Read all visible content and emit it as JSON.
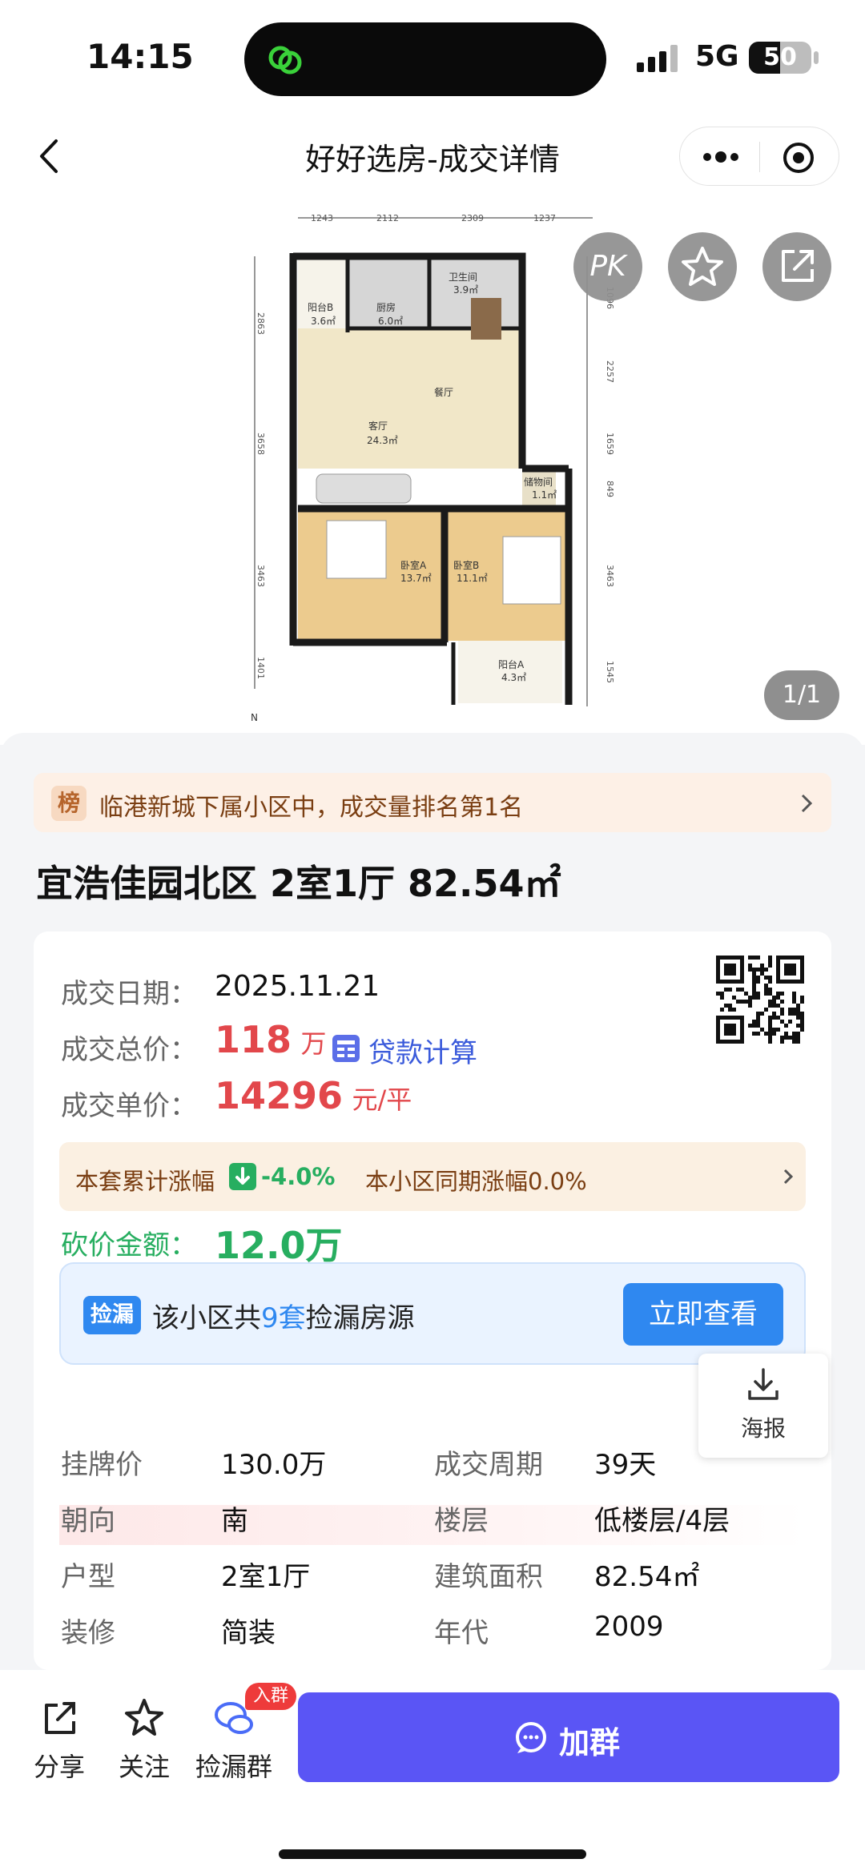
{
  "status": {
    "time": "14:15",
    "network": "5G",
    "battery": "50",
    "battery_level": 0.5
  },
  "nav": {
    "title": "好好选房-成交详情"
  },
  "floorplan": {
    "dims_top": [
      "1243",
      "2112",
      "2309",
      "1237"
    ],
    "dims_left": [
      "2863",
      "3658",
      "3463",
      "1401"
    ],
    "dims_right": [
      "1096",
      "2257",
      "1659",
      "849",
      "3463",
      "1545"
    ],
    "rooms": [
      {
        "name": "阳台B",
        "area": "3.6㎡"
      },
      {
        "name": "厨房",
        "area": "6.0㎡"
      },
      {
        "name": "卫生间",
        "area": "3.9㎡"
      },
      {
        "name": "餐厅",
        "area": ""
      },
      {
        "name": "客厅",
        "area": "24.3㎡"
      },
      {
        "name": "储物间",
        "area": "1.1㎡"
      },
      {
        "name": "卧室A",
        "area": "13.7㎡"
      },
      {
        "name": "卧室B",
        "area": "11.1㎡"
      },
      {
        "name": "阳台A",
        "area": "4.3㎡"
      }
    ],
    "compass": "N",
    "pk_label": "PK",
    "pager": "1/1"
  },
  "rank": {
    "tag": "榜",
    "text": "临港新城下属小区中，成交量排名第1名"
  },
  "house": {
    "title": "宜浩佳园北区 2室1厅 82.54㎡"
  },
  "deal": {
    "date_label": "成交日期：",
    "date": "2025.11.21",
    "total_label": "成交总价：",
    "total": "118",
    "total_unit": "万",
    "loan_label": "贷款计算",
    "unit_label": "成交单价：",
    "unit_price": "14296",
    "unit_price_unit": "元/平",
    "rise_label": "本套累计涨幅",
    "rise_value": "-4.0%",
    "community_rise": "本小区同期涨幅0.0%",
    "cut_label": "砍价金额：",
    "cut_value": "12.0万"
  },
  "leak": {
    "tag": "捡漏",
    "prefix": "该小区共",
    "count": "9套",
    "suffix": "捡漏房源",
    "button": "立即查看"
  },
  "poster": {
    "label": "海报"
  },
  "details": [
    {
      "label": "挂牌价",
      "value": "130.0万",
      "label2": "成交周期",
      "value2": "39天"
    },
    {
      "label": "朝向",
      "value": "南",
      "label2": "楼层",
      "value2": "低楼层/4层"
    },
    {
      "label": "户型",
      "value": "2室1厅",
      "label2": "建筑面积",
      "value2": "82.54㎡"
    },
    {
      "label": "装修",
      "value": "简装",
      "label2": "年代",
      "value2": "2009"
    }
  ],
  "bottom": {
    "share": "分享",
    "follow": "关注",
    "group": "捡漏群",
    "badge": "入群",
    "join": "加群"
  },
  "colors": {
    "accent_red": "#e2474b",
    "accent_green": "#27ae60",
    "accent_blue": "#2f88f0",
    "join_button": "#5a55f5"
  }
}
